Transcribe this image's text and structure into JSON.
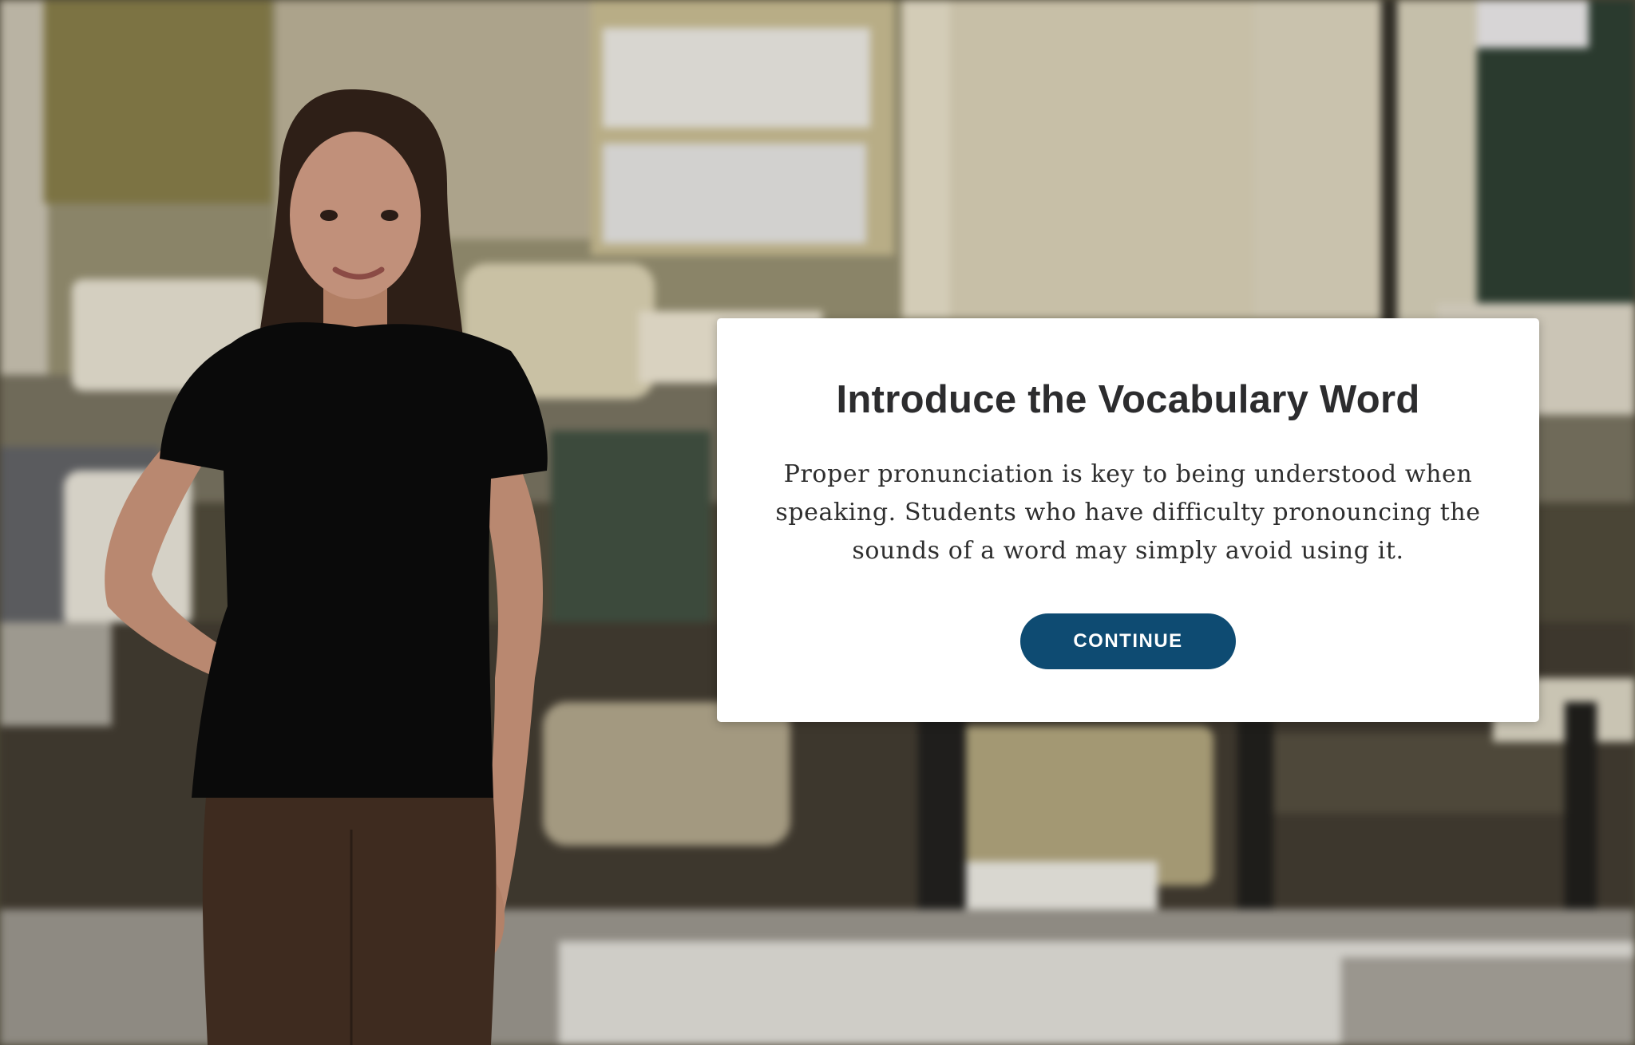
{
  "modal": {
    "title": "Introduce the Vocabulary Word",
    "body": "Proper pronunciation is key to being understood when speaking. Students who have difficulty pronouncing the sounds of a word may simply avoid using it.",
    "continue_label": "CONTINUE"
  },
  "colors": {
    "button_background": "#0e4b72",
    "button_text": "#ffffff",
    "modal_background": "#ffffff",
    "title_text": "#2c2c2e"
  },
  "scene": {
    "background": "blurred classroom",
    "character": "instructor"
  }
}
